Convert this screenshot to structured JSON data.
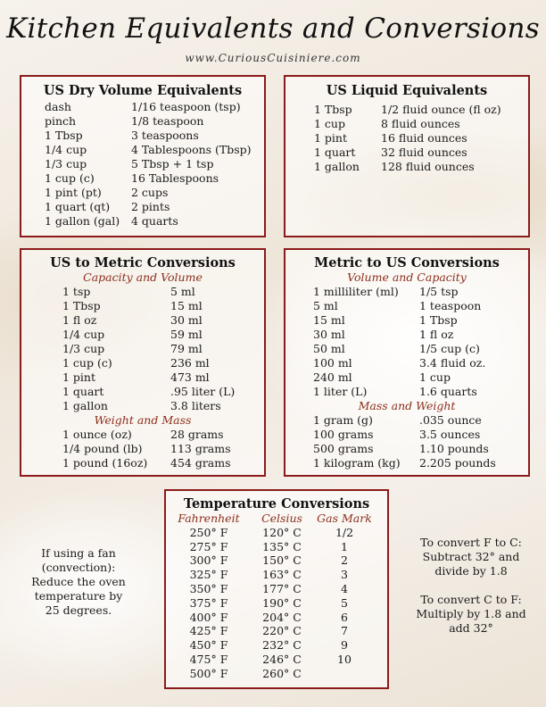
{
  "header": {
    "title": "Kitchen Equivalents and Conversions",
    "website": "www.CuriousCuisiniere.com"
  },
  "accent_colors": {
    "box_border": "#8b1a1a",
    "subheading": "#8b2e1a"
  },
  "us_dry_volume": {
    "title": "US Dry Volume Equivalents",
    "rows": [
      [
        "dash",
        "1/16 teaspoon (tsp)"
      ],
      [
        "pinch",
        "1/8 teaspoon"
      ],
      [
        "1 Tbsp",
        "3 teaspoons"
      ],
      [
        "1/4 cup",
        "4 Tablespoons (Tbsp)"
      ],
      [
        "1/3 cup",
        "5 Tbsp + 1 tsp"
      ],
      [
        "1 cup (c)",
        "16 Tablespoons"
      ],
      [
        "1 pint (pt)",
        "2 cups"
      ],
      [
        "1 quart (qt)",
        "2 pints"
      ],
      [
        "1 gallon (gal)",
        "4 quarts"
      ]
    ]
  },
  "us_liquid": {
    "title": "US Liquid Equivalents",
    "rows": [
      [
        "1 Tbsp",
        "1/2 fluid ounce (fl oz)"
      ],
      [
        "1 cup",
        "8 fluid ounces"
      ],
      [
        "1 pint",
        "16 fluid ounces"
      ],
      [
        "1 quart",
        "32 fluid ounces"
      ],
      [
        "1 gallon",
        "128 fluid ounces"
      ]
    ]
  },
  "us_to_metric": {
    "title": "US to Metric Conversions",
    "sections": [
      {
        "heading": "Capacity and Volume",
        "rows": [
          [
            "1 tsp",
            "5 ml"
          ],
          [
            "1 Tbsp",
            "15 ml"
          ],
          [
            "1 fl oz",
            "30 ml"
          ],
          [
            "1/4 cup",
            "59 ml"
          ],
          [
            "1/3 cup",
            "79 ml"
          ],
          [
            "1 cup (c)",
            "236 ml"
          ],
          [
            "1 pint",
            "473 ml"
          ],
          [
            "1 quart",
            ".95 liter (L)"
          ],
          [
            "1 gallon",
            "3.8 liters"
          ]
        ]
      },
      {
        "heading": "Weight and Mass",
        "rows": [
          [
            "1 ounce (oz)",
            "28 grams"
          ],
          [
            "1/4 pound (lb)",
            "113 grams"
          ],
          [
            "1 pound (16oz)",
            "454 grams"
          ]
        ]
      }
    ]
  },
  "metric_to_us": {
    "title": "Metric to US Conversions",
    "sections": [
      {
        "heading": "Volume and Capacity",
        "rows": [
          [
            "1 milliliter (ml)",
            "1/5 tsp"
          ],
          [
            "5 ml",
            "1 teaspoon"
          ],
          [
            "15 ml",
            "1 Tbsp"
          ],
          [
            "30 ml",
            "1 fl oz"
          ],
          [
            "50 ml",
            "1/5 cup (c)"
          ],
          [
            "100 ml",
            "3.4 fluid oz."
          ],
          [
            "240 ml",
            "1 cup"
          ],
          [
            "1 liter (L)",
            "1.6 quarts"
          ]
        ]
      },
      {
        "heading": "Mass and Weight",
        "rows": [
          [
            "1 gram (g)",
            ".035 ounce"
          ],
          [
            "100 grams",
            "3.5 ounces"
          ],
          [
            "500 grams",
            "1.10 pounds"
          ],
          [
            "1 kilogram (kg)",
            "2.205 pounds"
          ]
        ]
      }
    ]
  },
  "temperature": {
    "title": "Temperature Conversions",
    "columns": [
      "Fahrenheit",
      "Celsius",
      "Gas Mark"
    ],
    "rows": [
      [
        "250° F",
        "120° C",
        "1/2"
      ],
      [
        "275° F",
        "135° C",
        "1"
      ],
      [
        "300° F",
        "150° C",
        "2"
      ],
      [
        "325° F",
        "163° C",
        "3"
      ],
      [
        "350° F",
        "177° C",
        "4"
      ],
      [
        "375° F",
        "190° C",
        "5"
      ],
      [
        "400° F",
        "204° C",
        "6"
      ],
      [
        "425° F",
        "220° C",
        "7"
      ],
      [
        "450° F",
        "232° C",
        "9"
      ],
      [
        "475° F",
        "246° C",
        "10"
      ],
      [
        "500° F",
        "260° C",
        ""
      ]
    ]
  },
  "notes": {
    "fan": [
      "If using a fan",
      "(convection):",
      "Reduce the oven",
      "temperature by",
      "25 degrees."
    ],
    "f_to_c": [
      "To convert F to C:",
      "Subtract 32°  and",
      "divide by 1.8"
    ],
    "c_to_f": [
      "To convert C to F:",
      "Multiply by 1.8 and",
      "add 32°"
    ]
  }
}
